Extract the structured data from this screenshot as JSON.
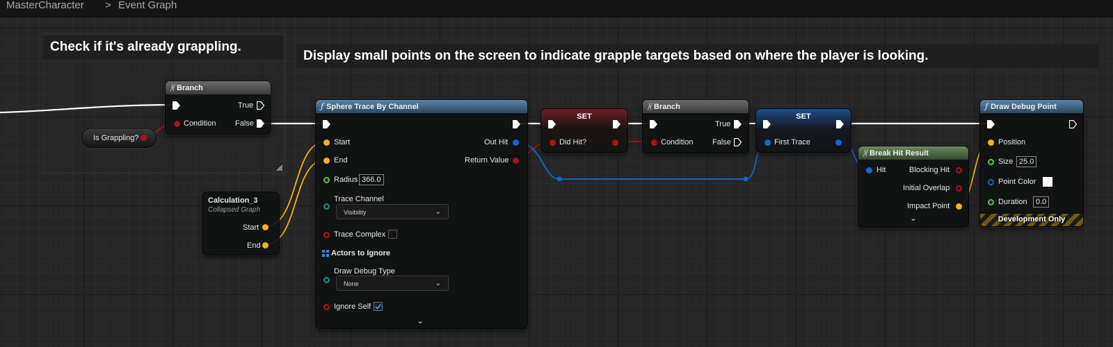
{
  "breadcrumb": {
    "blueprint": "MasterCharacter",
    "separator": ">",
    "graph": "Event Graph"
  },
  "comments": {
    "grappling_check": "Check if it's already grappling.",
    "grapple_targets": "Display small points on the screen to indicate grapple targets based on where the player is looking."
  },
  "nodes": {
    "branch1": {
      "title": "Branch",
      "true_label": "True",
      "condition_label": "Condition",
      "false_label": "False"
    },
    "is_grappling": {
      "label": "Is Grappling?"
    },
    "calculation": {
      "title": "Calculation_3",
      "subtitle": "Collapsed Graph",
      "start_label": "Start",
      "end_label": "End"
    },
    "sphere_trace": {
      "title": "Sphere Trace By Channel",
      "start_label": "Start",
      "end_label": "End",
      "radius_label": "Radius",
      "radius_value": "366.0",
      "trace_channel_label": "Trace Channel",
      "trace_channel_value": "Visibility",
      "trace_complex_label": "Trace Complex",
      "actors_to_ignore_label": "Actors to Ignore",
      "draw_debug_type_label": "Draw Debug Type",
      "draw_debug_type_value": "None",
      "ignore_self_label": "Ignore Self",
      "ignore_self_checked": true,
      "out_hit_label": "Out Hit",
      "return_value_label": "Return Value"
    },
    "set_did_hit": {
      "title": "SET",
      "var_label": "Did Hit?"
    },
    "branch2": {
      "title": "Branch",
      "true_label": "True",
      "condition_label": "Condition",
      "false_label": "False"
    },
    "set_first_trace": {
      "title": "SET",
      "var_label": "First Trace"
    },
    "break_hit": {
      "title": "Break Hit Result",
      "hit_label": "Hit",
      "blocking_hit_label": "Blocking Hit",
      "initial_overlap_label": "Initial Overlap",
      "impact_point_label": "Impact Point"
    },
    "draw_debug_point": {
      "title": "Draw Debug Point",
      "position_label": "Position",
      "size_label": "Size",
      "size_value": "25.0",
      "point_color_label": "Point Color",
      "point_color_value": "#ffffff",
      "duration_label": "Duration",
      "duration_value": "0.0",
      "dev_only_label": "Development Only"
    }
  },
  "colors": {
    "exec_wire": "#ffffff",
    "bool_pin": "#a8141a",
    "vector_pin": "#f0b418",
    "struct_pin": "#1664c8",
    "float_pin": "#58c248",
    "enum_pin": "#1e8c82"
  },
  "icons": [
    "chevron-right-icon",
    "branch-icon",
    "function-icon",
    "exec-pin-icon",
    "grid-icon",
    "chevron-down-icon",
    "resize-icon",
    "checkmark-icon"
  ]
}
